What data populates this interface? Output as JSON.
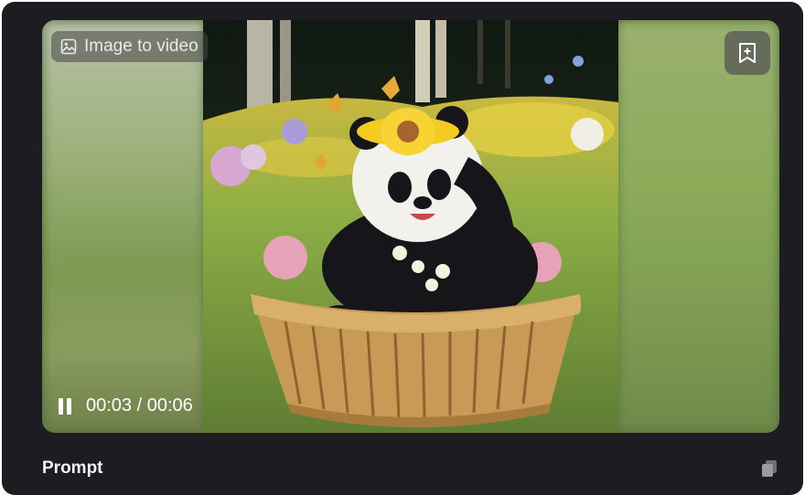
{
  "player": {
    "badge_label": "Image to video",
    "badge_icon": "image-icon",
    "bookmark_icon": "bookmark-add-icon",
    "playback_state": "playing",
    "current_time": "00:03",
    "separator": "/",
    "duration": "00:06"
  },
  "prompt": {
    "label": "Prompt",
    "copy_icon": "copy-icon"
  },
  "colors": {
    "card_bg": "#1c1c21",
    "text": "#ffffff"
  }
}
